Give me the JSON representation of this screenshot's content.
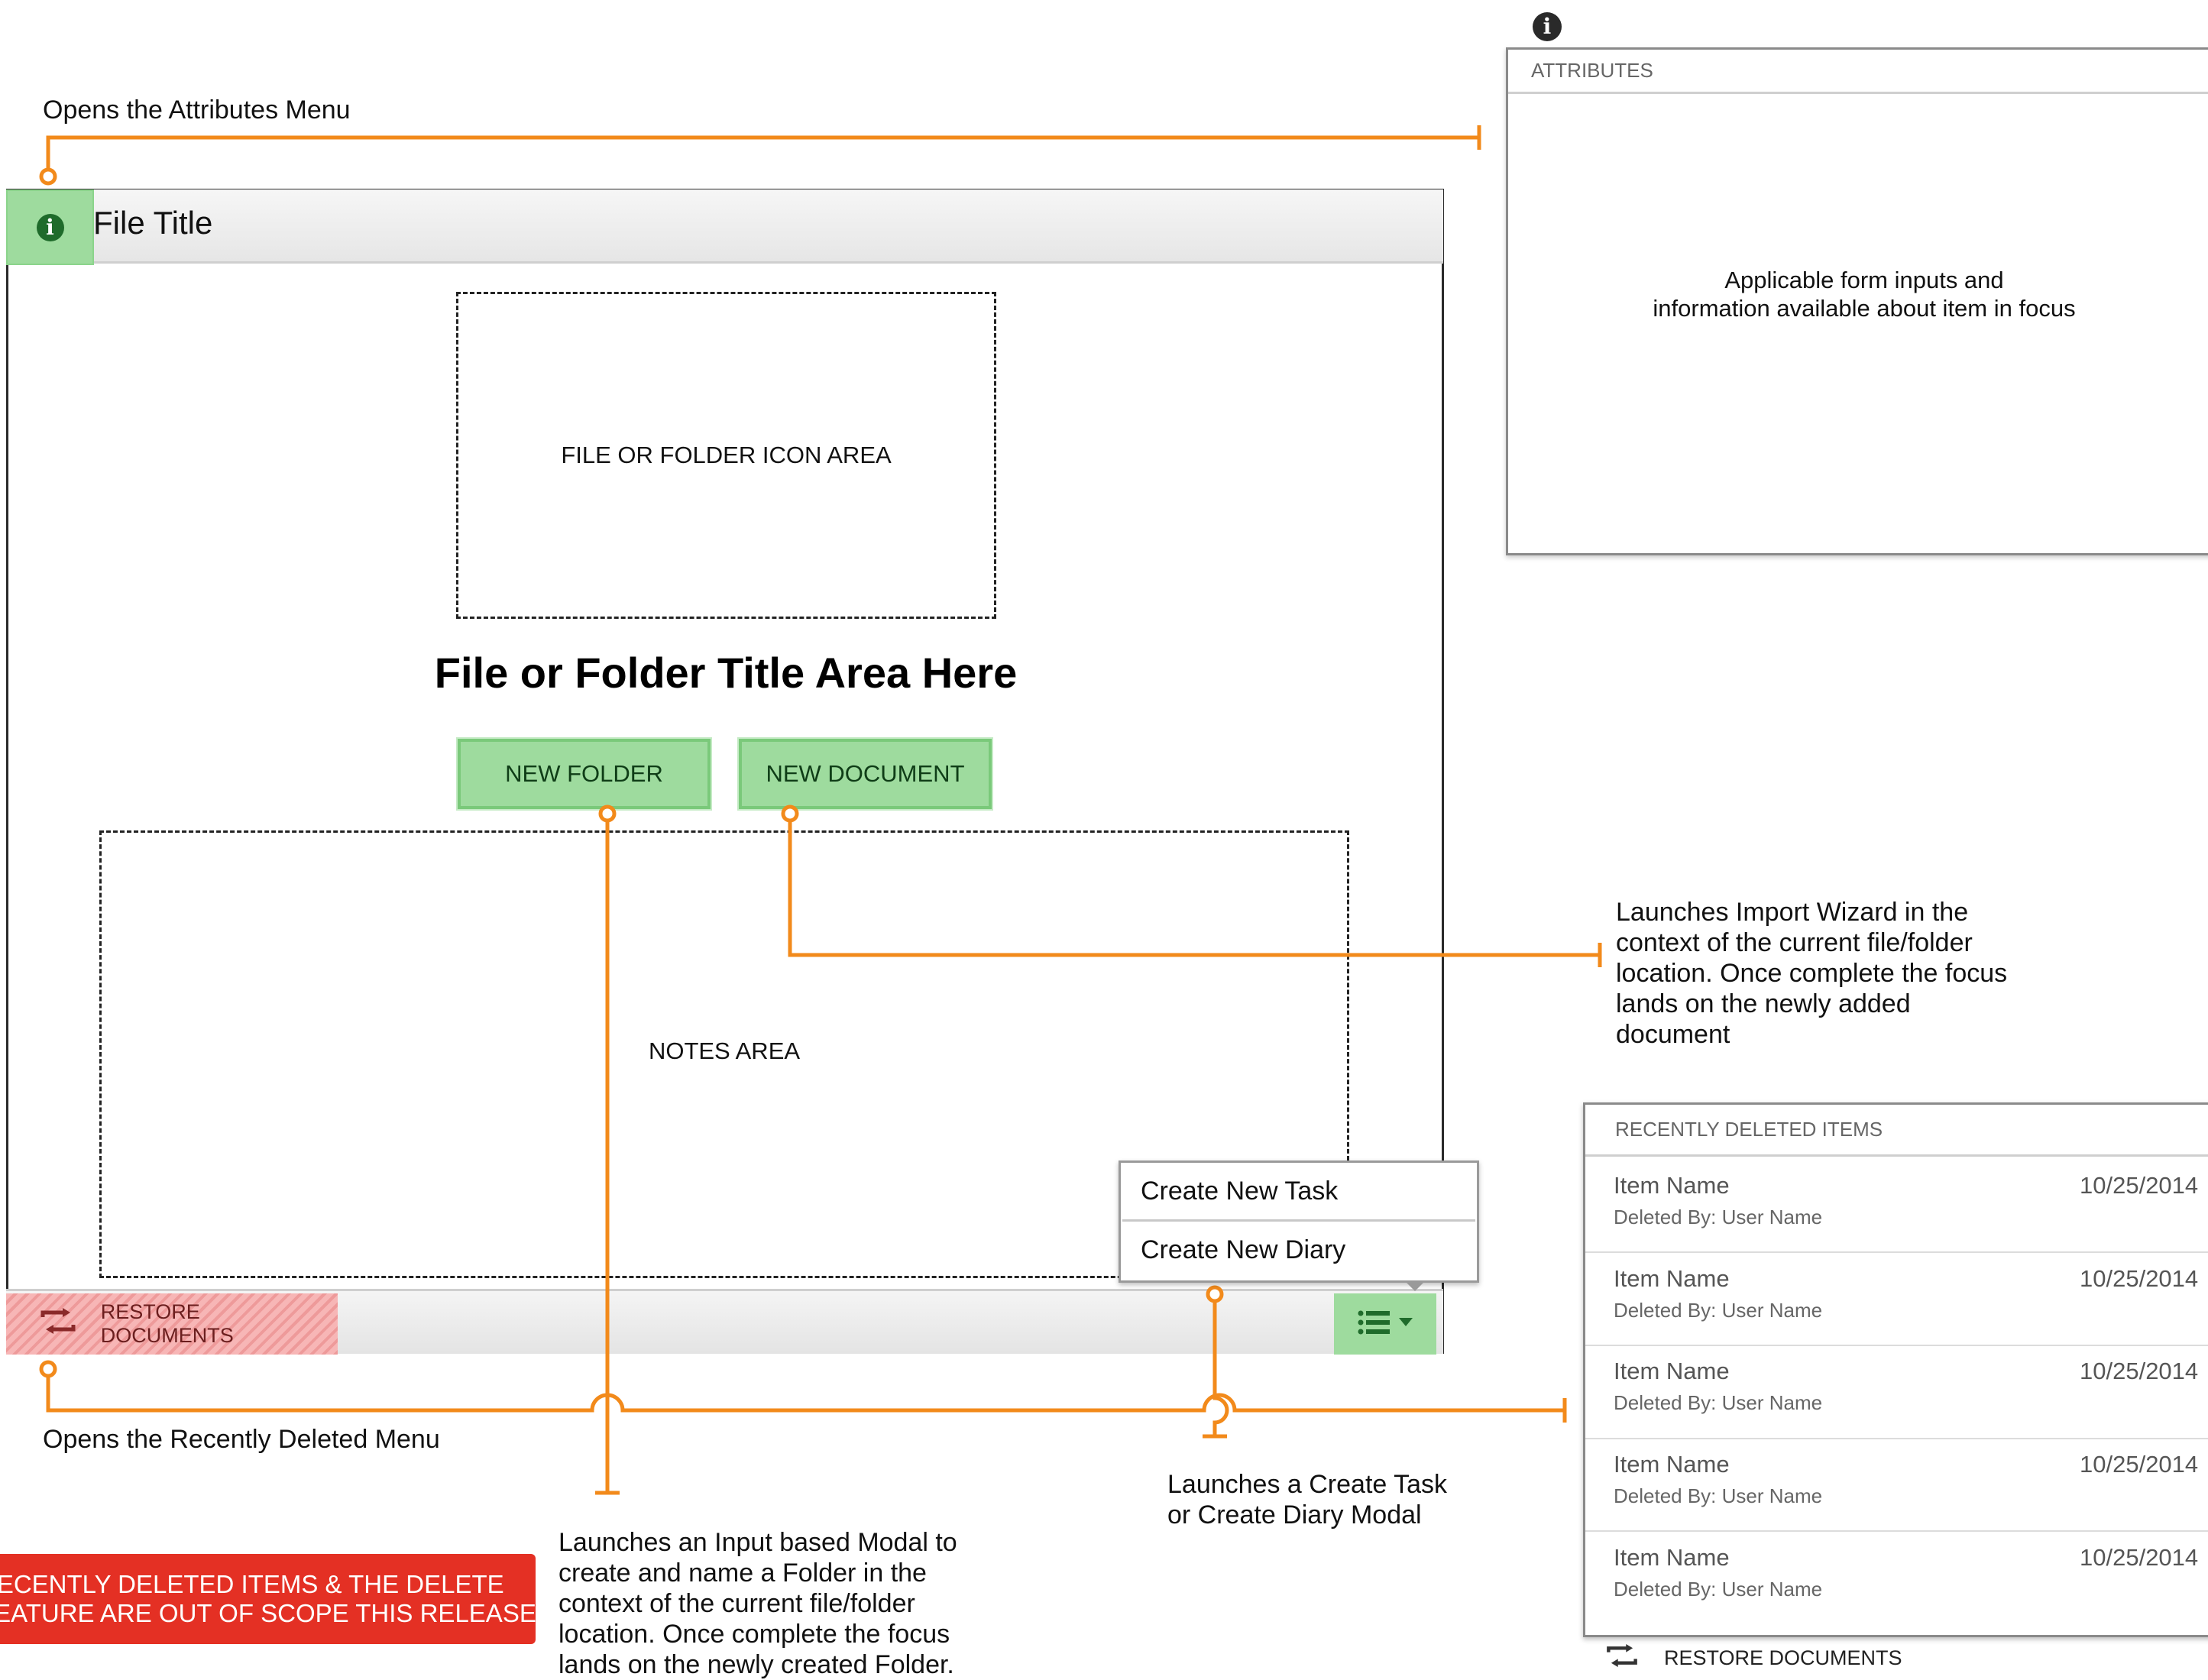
{
  "main_panel": {
    "file_title": "File Title",
    "icon_area_label": "FILE OR FOLDER ICON AREA",
    "folder_title": "File or Folder Title Area Here",
    "new_folder_label": "NEW FOLDER",
    "new_document_label": "NEW DOCUMENT",
    "notes_area_label": "NOTES AREA",
    "restore_label": "RESTORE DOCUMENTS",
    "create_menu": [
      "Create New Task",
      "Create New Diary"
    ]
  },
  "attributes_panel": {
    "header": "ATTRIBUTES",
    "body_line1": "Applicable form inputs and",
    "body_line2": "information available about item in focus"
  },
  "recently_deleted_panel": {
    "header": "RECENTLY DELETED ITEMS",
    "items": [
      {
        "name": "Item Name",
        "deleted_by": "Deleted By: User Name",
        "date": "10/25/2014"
      },
      {
        "name": "Item Name",
        "deleted_by": "Deleted By: User Name",
        "date": "10/25/2014"
      },
      {
        "name": "Item Name",
        "deleted_by": "Deleted By: User Name",
        "date": "10/25/2014"
      },
      {
        "name": "Item Name",
        "deleted_by": "Deleted By: User Name",
        "date": "10/25/2014"
      },
      {
        "name": "Item Name",
        "deleted_by": "Deleted By: User Name",
        "date": "10/25/2014"
      }
    ],
    "restore_label": "RESTORE DOCUMENTS"
  },
  "annotations": {
    "attributes_menu": "Opens the Attributes Menu",
    "recently_deleted_menu": "Opens the Recently Deleted Menu",
    "import_wizard": [
      "Launches Import Wizard in the",
      "context of the current file/folder",
      "location. Once complete the focus",
      "lands on the newly added",
      "document"
    ],
    "create_task": [
      "Launches a Create Task",
      "or Create Diary Modal"
    ],
    "input_modal": [
      "Launches an Input based Modal to",
      "create and name a Folder in the",
      "context of the current file/folder",
      "location. Once complete the focus",
      "lands on the newly created Folder."
    ],
    "scope_warning": [
      "RECENTLY DELETED ITEMS & THE DELETE",
      "FEATURE ARE OUT OF SCOPE THIS RELEASE"
    ]
  },
  "colors": {
    "connector": "#f28a1b",
    "button_green": "#9edb9e",
    "warning_red": "#e43024",
    "restore_red": "#f7b6b6"
  },
  "icons": {
    "info": "info-icon",
    "restore": "restore-icon",
    "list_menu": "list-icon",
    "caret": "caret-down-icon"
  }
}
